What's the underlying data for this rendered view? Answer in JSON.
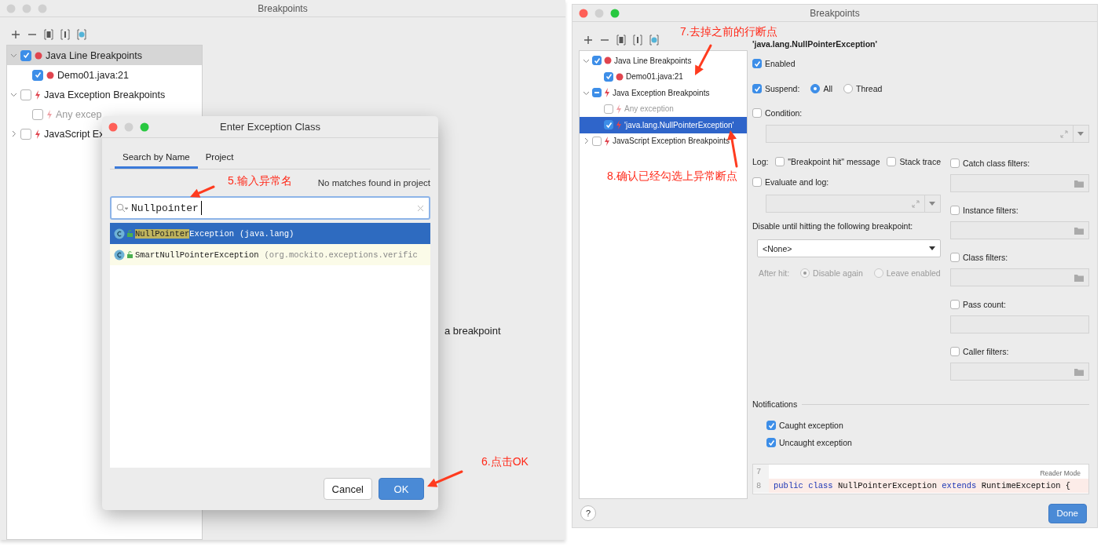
{
  "left_window": {
    "title": "Breakpoints",
    "active": false,
    "tree": [
      {
        "label": "Java Line Breakpoints",
        "kind": "line",
        "checked": true,
        "selected": true,
        "expanded": true,
        "disabled": false,
        "children": [
          {
            "label": "Demo01.java:21",
            "kind": "line",
            "checked": true,
            "selected": false,
            "disabled": false
          }
        ]
      },
      {
        "label": "Java Exception Breakpoints",
        "kind": "exception",
        "checked": false,
        "selected": false,
        "expanded": true,
        "disabled": false,
        "children": [
          {
            "label": "Any excep",
            "kind": "exception",
            "checked": false,
            "selected": false,
            "disabled": true
          }
        ]
      },
      {
        "label": "JavaScript Ex",
        "kind": "exception",
        "checked": false,
        "selected": false,
        "expanded": false,
        "disabled": false
      }
    ],
    "hint": "a breakpoint"
  },
  "dialog": {
    "title": "Enter Exception Class",
    "tabs": [
      {
        "label": "Search by Name",
        "selected": true
      },
      {
        "label": "Project",
        "selected": false
      }
    ],
    "status": "No matches found in project",
    "search": {
      "value": "Nullpointer"
    },
    "results": [
      {
        "name_parts": [
          {
            "text": "NullPointer",
            "highlighted": true
          },
          {
            "text": "Exception",
            "highlighted": false
          }
        ],
        "package": "(java.lang)",
        "selected": true
      },
      {
        "name_parts": [
          {
            "text": "SmartNullPointerException",
            "highlighted": false
          }
        ],
        "package": "(org.mockito.exceptions.verific",
        "selected": false
      }
    ],
    "buttons": [
      {
        "label": "Cancel",
        "kind": "secondary"
      },
      {
        "label": "OK",
        "kind": "primary"
      }
    ]
  },
  "right_window": {
    "title": "Breakpoints",
    "active": true,
    "tree": [
      {
        "label": "Java Line Breakpoints",
        "kind": "line",
        "checked": true,
        "selected": false,
        "expanded": true,
        "disabled": false,
        "children": [
          {
            "label": "Demo01.java:21",
            "kind": "line",
            "checked": true,
            "selected": false,
            "disabled": false
          }
        ]
      },
      {
        "label": "Java Exception Breakpoints",
        "kind": "exception",
        "checked": false,
        "partial": true,
        "selected": false,
        "expanded": true,
        "disabled": false,
        "children": [
          {
            "label": "Any exception",
            "kind": "exception",
            "checked": false,
            "selected": false,
            "disabled": true
          },
          {
            "label": "'java.lang.NullPointerException'",
            "kind": "exception",
            "checked": true,
            "selected": true,
            "disabled": false
          }
        ]
      },
      {
        "label": "JavaScript Exception Breakpoints",
        "kind": "exception",
        "checked": false,
        "selected": false,
        "expanded": false,
        "disabled": false
      }
    ],
    "details": {
      "heading": "'java.lang.NullPointerException'",
      "enabled": {
        "label": "Enabled",
        "checked": true
      },
      "suspend": {
        "label": "Suspend:",
        "checked": true,
        "options": [
          {
            "label": "All",
            "selected": true
          },
          {
            "label": "Thread",
            "selected": false
          }
        ]
      },
      "condition": {
        "label": "Condition:",
        "checked": false
      },
      "log": {
        "label": "Log:",
        "options": [
          {
            "label": "\"Breakpoint hit\" message",
            "checked": false
          },
          {
            "label": "Stack trace",
            "checked": false
          }
        ]
      },
      "evaluate": {
        "label": "Evaluate and log:",
        "checked": false
      },
      "disable_until": {
        "label": "Disable until hitting the following breakpoint:",
        "value": "<None>"
      },
      "after_hit": {
        "label": "After hit:",
        "disabled": true,
        "options": [
          {
            "label": "Disable again",
            "selected": true
          },
          {
            "label": "Leave enabled",
            "selected": false
          }
        ]
      },
      "filters": [
        {
          "label": "Catch class filters:",
          "checked": false,
          "kind": "browse"
        },
        {
          "label": "Instance filters:",
          "checked": false,
          "kind": "browse"
        },
        {
          "label": "Class filters:",
          "checked": false,
          "kind": "browse"
        },
        {
          "label": "Pass count:",
          "checked": false,
          "kind": "plain"
        },
        {
          "label": "Caller filters:",
          "checked": false,
          "kind": "browse"
        }
      ],
      "notifications": {
        "label": "Notifications",
        "options": [
          {
            "label": "Caught exception",
            "checked": true
          },
          {
            "label": "Uncaught exception",
            "checked": true
          }
        ]
      },
      "code": {
        "reader_mode": "Reader Mode",
        "lines": [
          {
            "number": "7",
            "highlighted": false
          },
          {
            "number": "8",
            "highlighted": true,
            "tokens": [
              {
                "text": "public",
                "kind": "keyword"
              },
              {
                "text": "class",
                "kind": "keyword"
              },
              {
                "text": "NullPointerException",
                "kind": "plain"
              },
              {
                "text": "extends",
                "kind": "keyword"
              },
              {
                "text": "RuntimeException {",
                "kind": "plain"
              }
            ]
          }
        ]
      }
    },
    "help": "?",
    "done": "Done"
  },
  "annotations": [
    {
      "text": "5.输入异常名"
    },
    {
      "text": "6.点击OK"
    },
    {
      "text": "7.去掉之前的行断点"
    },
    {
      "text": "8.确认已经勾选上异常断点"
    }
  ]
}
